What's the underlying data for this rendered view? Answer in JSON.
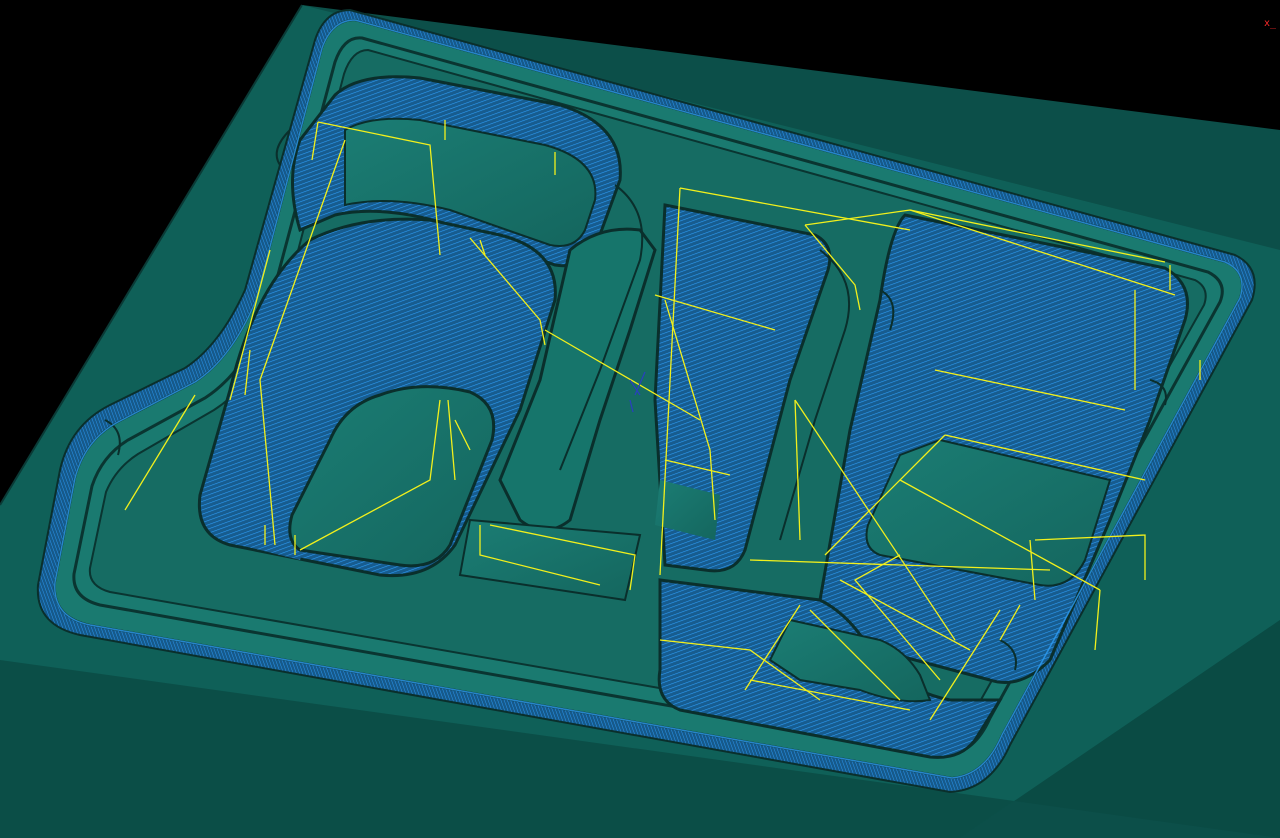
{
  "viewport": {
    "background": "#000000",
    "axis_indicator": "x_"
  },
  "colors": {
    "stock_side": "#0b5a52",
    "stock_top": "#126c63",
    "part_top": "#1a7e74",
    "wall": "#1d6e8a",
    "toolpath_cut": "#1e8ef0",
    "toolpath_link": "#f2f01c",
    "edge": "#0a2f2c",
    "axis": "#ff2a2a"
  },
  "scene": {
    "icons": [
      "stock-block",
      "tray-part",
      "pocket",
      "cut-toolpath",
      "link-moves",
      "view-axis-triad"
    ]
  }
}
